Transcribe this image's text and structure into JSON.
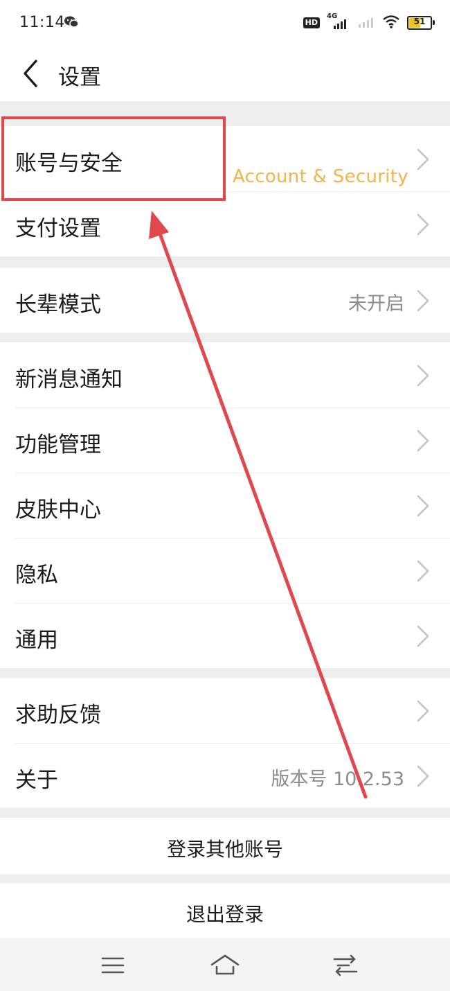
{
  "status_bar": {
    "time": "11:14",
    "network": "4G",
    "hd_label": "HD",
    "battery_percent": 51,
    "battery_label": "51"
  },
  "header": {
    "back_icon": "chevron-left-icon",
    "title": "设置"
  },
  "groups": [
    {
      "items": [
        {
          "label": "账号与安全",
          "value": ""
        },
        {
          "label": "支付设置",
          "value": ""
        }
      ]
    },
    {
      "items": [
        {
          "label": "长辈模式",
          "value": "未开启"
        }
      ]
    },
    {
      "items": [
        {
          "label": "新消息通知",
          "value": ""
        },
        {
          "label": "功能管理",
          "value": ""
        },
        {
          "label": "皮肤中心",
          "value": ""
        },
        {
          "label": "隐私",
          "value": ""
        },
        {
          "label": "通用",
          "value": ""
        }
      ]
    },
    {
      "items": [
        {
          "label": "求助反馈",
          "value": ""
        },
        {
          "label": "关于",
          "value": "版本号 10.2.53"
        }
      ]
    }
  ],
  "actions": {
    "switch_account": "登录其他账号",
    "logout": "退出登录"
  },
  "annotation": {
    "caption": "Account & Security",
    "box_color": "#e0484d",
    "caption_color": "#f2b34a"
  },
  "nav_bar": {
    "menu_icon": "menu-icon",
    "home_icon": "home-icon",
    "back_icon": "return-icon"
  }
}
